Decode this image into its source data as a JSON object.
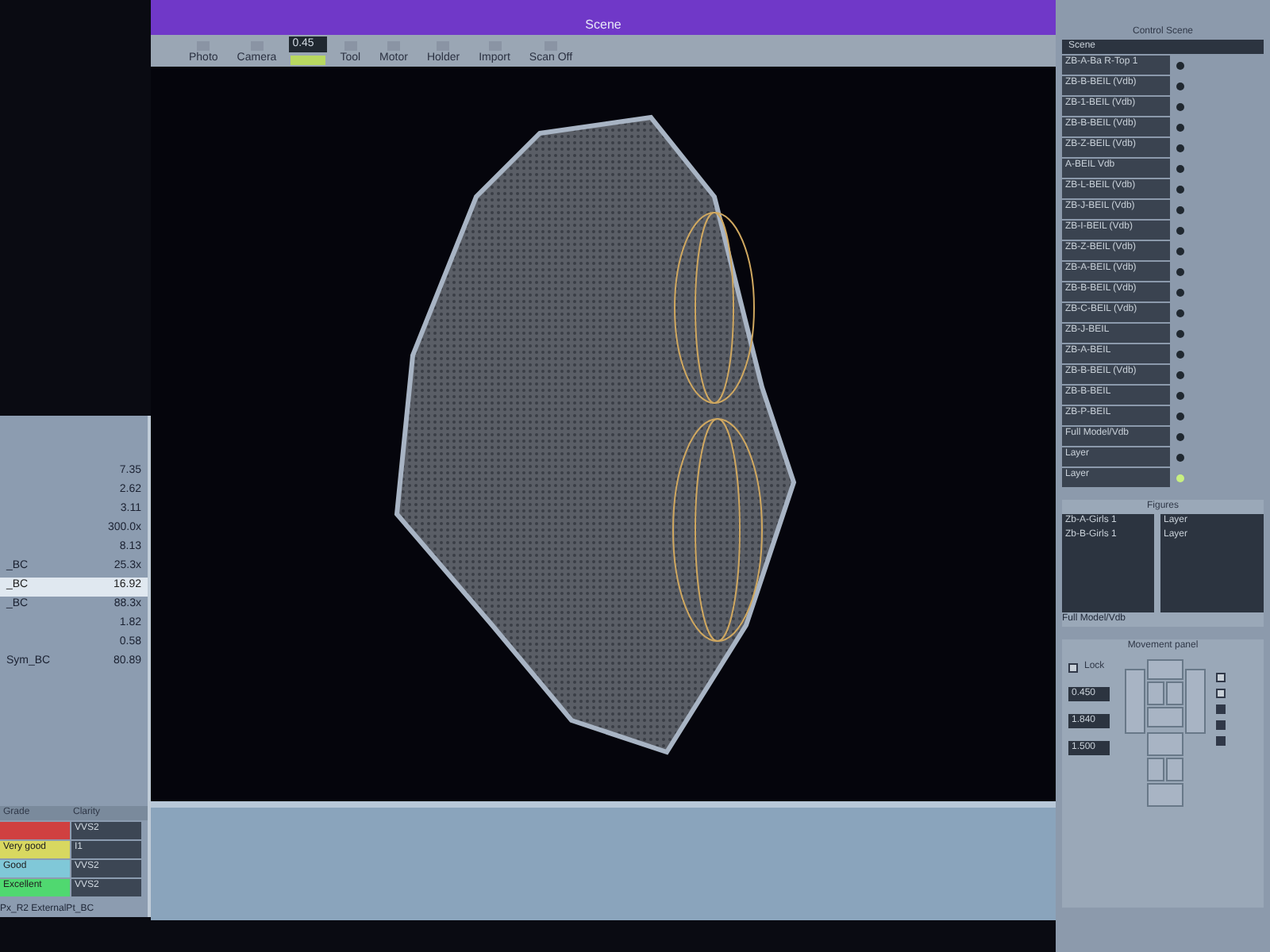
{
  "window": {
    "title": "Scene"
  },
  "toolbar": [
    {
      "kind": "button",
      "label": "Photo"
    },
    {
      "kind": "button",
      "label": "Camera"
    },
    {
      "kind": "field",
      "value": "0.45"
    },
    {
      "kind": "button",
      "label": "Tool"
    },
    {
      "kind": "button",
      "label": "Motor"
    },
    {
      "kind": "button",
      "label": "Holder"
    },
    {
      "kind": "button",
      "label": "Import"
    },
    {
      "kind": "button",
      "label": "Scan Off"
    }
  ],
  "stats": [
    {
      "value": "7.35",
      "selected": false
    },
    {
      "value": "2.62",
      "selected": false
    },
    {
      "value": "3.11",
      "selected": false
    },
    {
      "value": "300.0x",
      "selected": false
    },
    {
      "value": "8.13",
      "selected": false
    },
    {
      "label": "_BC",
      "value": "25.3x",
      "selected": false
    },
    {
      "label": "_BC",
      "value": "16.92",
      "selected": true
    },
    {
      "label": "_BC",
      "value": "88.3x",
      "selected": false
    },
    {
      "value": "1.82",
      "selected": false
    },
    {
      "value": "0.58",
      "selected": false
    },
    {
      "label": "Sym_BC",
      "value": "80.89",
      "selected": false
    }
  ],
  "grades": {
    "columns": [
      "Grade",
      "Clarity"
    ],
    "rows": [
      {
        "color": "#d04040",
        "clarity": "VVS2"
      },
      {
        "grade": "Very good",
        "color": "#d8d860",
        "clarity": "I1"
      },
      {
        "grade": "Good",
        "color": "#80c8d8",
        "clarity": "VVS2"
      },
      {
        "grade": "Excellent",
        "color": "#50d870",
        "clarity": "VVS2"
      }
    ],
    "footer": "Px_R2 ExternalPt_BC"
  },
  "control_scene": {
    "title": "Control Scene",
    "header": "Scene",
    "items": [
      {
        "name": "ZB-A-Ba R-Top 1",
        "lit": false
      },
      {
        "name": "ZB-B-BEIL (Vdb)",
        "lit": false
      },
      {
        "name": "ZB-1-BEIL (Vdb)",
        "lit": false
      },
      {
        "name": "ZB-B-BEIL (Vdb)",
        "lit": false
      },
      {
        "name": "ZB-Z-BEIL (Vdb)",
        "lit": false
      },
      {
        "name": "A-BEIL Vdb",
        "lit": false
      },
      {
        "name": "ZB-L-BEIL (Vdb)",
        "lit": false
      },
      {
        "name": "ZB-J-BEIL (Vdb)",
        "lit": false
      },
      {
        "name": "ZB-I-BEIL (Vdb)",
        "lit": false
      },
      {
        "name": "ZB-Z-BEIL (Vdb)",
        "lit": false
      },
      {
        "name": "ZB-A-BEIL (Vdb)",
        "lit": false
      },
      {
        "name": "ZB-B-BEIL (Vdb)",
        "lit": false
      },
      {
        "name": "ZB-C-BEIL (Vdb)",
        "lit": false
      },
      {
        "name": "ZB-J-BEIL",
        "lit": false
      },
      {
        "name": "ZB-A-BEIL",
        "lit": false
      },
      {
        "name": "ZB-B-BEIL (Vdb)",
        "lit": false
      },
      {
        "name": "ZB-B-BEIL",
        "lit": false
      },
      {
        "name": "ZB-P-BEIL",
        "lit": false
      },
      {
        "name": "Full Model/Vdb",
        "lit": false
      },
      {
        "name": "Layer",
        "lit": false
      },
      {
        "name": "Layer",
        "lit": true
      }
    ]
  },
  "figures": {
    "title": "Figures",
    "left": [
      "Zb-A-Girls 1",
      "Zb-B-Girls 1"
    ],
    "right": [
      "Layer",
      "Layer"
    ],
    "footer": "Full Model/Vdb"
  },
  "movement": {
    "title": "Movement panel",
    "lock": {
      "label": "Lock",
      "checked": false
    },
    "fields": [
      "0.450",
      "1.840",
      "1.500"
    ],
    "options": [
      {
        "checked": false
      },
      {
        "checked": false
      },
      {
        "checked": true
      },
      {
        "checked": true
      },
      {
        "checked": true
      }
    ]
  }
}
